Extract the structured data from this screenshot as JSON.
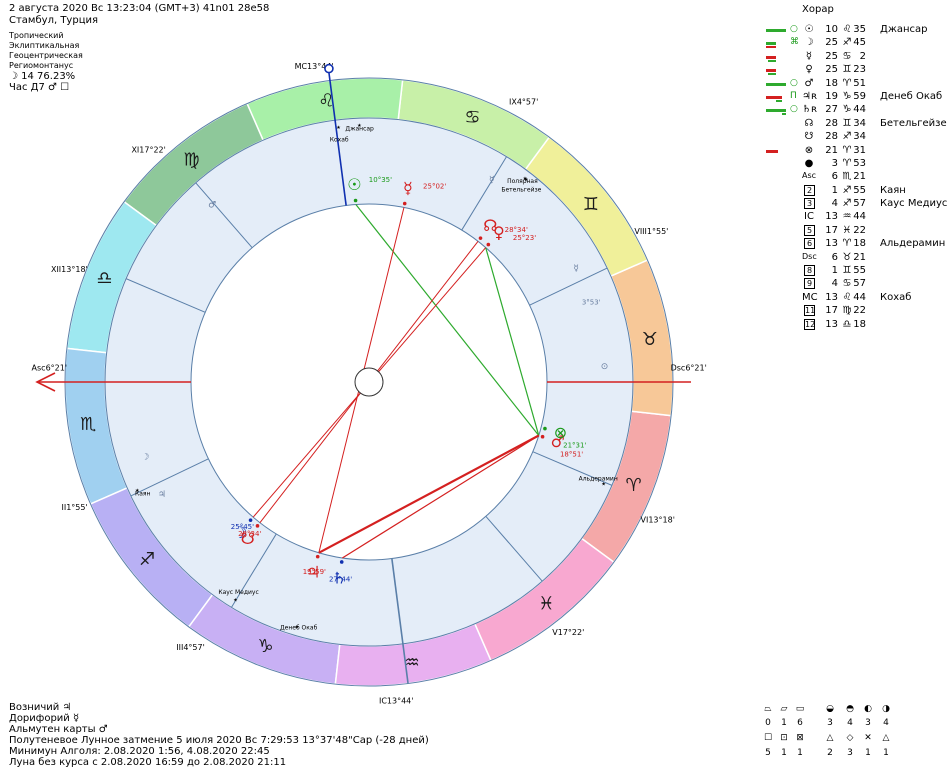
{
  "header": {
    "date_line": "2 августа 2020  Вс  13:23:04 (GMT+3) 41n01  28e58",
    "place": "Стамбул, Турция",
    "settings": [
      "Тропический",
      "Эклиптикальная",
      "Геоцентрическая",
      "Региомонтанус"
    ],
    "moon_phase": "☽  14 76.23%",
    "hour_line": "Час Д7  ♂ ☐"
  },
  "right_title": "Хорар",
  "planets": [
    {
      "mark": "○",
      "sym": "☉",
      "deg": "10",
      "sign": "♌",
      "min": "35",
      "star": "Джансар",
      "bar1": "#2eaa2e",
      "bar1w": 20,
      "bar2": "#2eaa2e",
      "bar2w": 0
    },
    {
      "mark": "⌘",
      "sym": "☽",
      "deg": "25",
      "sign": "♐",
      "min": "45",
      "star": "",
      "bar1": "#2eaa2e",
      "bar1w": 10,
      "bar2": "#d42020",
      "bar2w": 10
    },
    {
      "mark": "",
      "sym": "☿",
      "deg": "25",
      "sign": "♋",
      "min": "2",
      "star": "",
      "bar1": "#d42020",
      "bar1w": 10,
      "bar2": "#2eaa2e",
      "bar2w": 8
    },
    {
      "mark": "",
      "sym": "♀",
      "deg": "25",
      "sign": "♊",
      "min": "23",
      "star": "",
      "bar1": "#d42020",
      "bar1w": 10,
      "bar2": "#2eaa2e",
      "bar2w": 8
    },
    {
      "mark": "○",
      "sym": "♂",
      "deg": "18",
      "sign": "♈",
      "min": "51",
      "star": "",
      "bar1": "#2eaa2e",
      "bar1w": 20,
      "bar2": "#2eaa2e",
      "bar2w": 0
    },
    {
      "mark": "П",
      "sym": "♃ʀ",
      "deg": "19",
      "sign": "♑",
      "min": "59",
      "star": "Денеб Окаб",
      "bar1": "#d42020",
      "bar1w": 16,
      "bar2": "#2eaa2e",
      "bar2w": 6
    },
    {
      "mark": "○",
      "sym": "♄ʀ",
      "deg": "27",
      "sign": "♑",
      "min": "44",
      "star": "",
      "bar1": "#2eaa2e",
      "bar1w": 20,
      "bar2": "#2eaa2e",
      "bar2w": 4
    },
    {
      "mark": "",
      "sym": "☊",
      "deg": "28",
      "sign": "♊",
      "min": "34",
      "star": "Бетельгейзе",
      "bar1": "",
      "bar1w": 0,
      "bar2": "",
      "bar2w": 0
    },
    {
      "mark": "",
      "sym": "☋",
      "deg": "28",
      "sign": "♐",
      "min": "34",
      "star": "",
      "bar1": "",
      "bar1w": 0,
      "bar2": "",
      "bar2w": 0
    },
    {
      "mark": "",
      "sym": "⊗",
      "deg": "21",
      "sign": "♈",
      "min": "31",
      "star": "",
      "bar1": "#d42020",
      "bar1w": 12,
      "bar2": "",
      "bar2w": 0
    },
    {
      "mark": "",
      "sym": "●",
      "deg": "3",
      "sign": "♈",
      "min": "53",
      "star": "",
      "bar1": "",
      "bar1w": 0,
      "bar2": "",
      "bar2w": 0
    },
    {
      "mark": "",
      "sym": "Asc",
      "deg": "6",
      "sign": "♏",
      "min": "21",
      "star": "",
      "bar1": "",
      "bar1w": 0,
      "bar2": "",
      "bar2w": 0
    },
    {
      "mark": "",
      "sym": "2",
      "deg": "1",
      "sign": "♐",
      "min": "55",
      "star": "Каян",
      "bar1": "",
      "bar1w": 0,
      "bar2": "",
      "bar2w": 0
    },
    {
      "mark": "",
      "sym": "3",
      "deg": "4",
      "sign": "♐",
      "min": "57",
      "star": "Каус Медиус",
      "bar1": "",
      "bar1w": 0,
      "bar2": "",
      "bar2w": 0
    },
    {
      "mark": "",
      "sym": "IC",
      "deg": "13",
      "sign": "♒",
      "min": "44",
      "star": "",
      "bar1": "",
      "bar1w": 0,
      "bar2": "",
      "bar2w": 0
    },
    {
      "mark": "",
      "sym": "5",
      "deg": "17",
      "sign": "♓",
      "min": "22",
      "star": "",
      "bar1": "",
      "bar1w": 0,
      "bar2": "",
      "bar2w": 0
    },
    {
      "mark": "",
      "sym": "6",
      "deg": "13",
      "sign": "♈",
      "min": "18",
      "star": "Альдерамин",
      "bar1": "",
      "bar1w": 0,
      "bar2": "",
      "bar2w": 0
    },
    {
      "mark": "",
      "sym": "Dsc",
      "deg": "6",
      "sign": "♉",
      "min": "21",
      "star": "",
      "bar1": "",
      "bar1w": 0,
      "bar2": "",
      "bar2w": 0
    },
    {
      "mark": "",
      "sym": "8",
      "deg": "1",
      "sign": "♊",
      "min": "55",
      "star": "",
      "bar1": "",
      "bar1w": 0,
      "bar2": "",
      "bar2w": 0
    },
    {
      "mark": "",
      "sym": "9",
      "deg": "4",
      "sign": "♋",
      "min": "57",
      "star": "",
      "bar1": "",
      "bar1w": 0,
      "bar2": "",
      "bar2w": 0
    },
    {
      "mark": "",
      "sym": "MC",
      "deg": "13",
      "sign": "♌",
      "min": "44",
      "star": "Кохаб",
      "bar1": "",
      "bar1w": 0,
      "bar2": "",
      "bar2w": 0
    },
    {
      "mark": "",
      "sym": "11",
      "deg": "17",
      "sign": "♍",
      "min": "22",
      "star": "",
      "bar1": "",
      "bar1w": 0,
      "bar2": "",
      "bar2w": 0
    },
    {
      "mark": "",
      "sym": "12",
      "deg": "13",
      "sign": "♎",
      "min": "18",
      "star": "",
      "bar1": "",
      "bar1w": 0,
      "bar2": "",
      "bar2w": 0
    }
  ],
  "signs": [
    {
      "glyph": "♈",
      "color": "#f4a8a8"
    },
    {
      "glyph": "♉",
      "color": "#f7c898"
    },
    {
      "glyph": "♊",
      "color": "#f0f09a"
    },
    {
      "glyph": "♋",
      "color": "#c8f0a8"
    },
    {
      "glyph": "♌",
      "color": "#a8f0a8"
    },
    {
      "glyph": "♍",
      "color": "#8ec89a"
    },
    {
      "glyph": "♎",
      "color": "#9ee8f0"
    },
    {
      "glyph": "♏",
      "color": "#a0d0f0"
    },
    {
      "glyph": "♐",
      "color": "#b8b0f4"
    },
    {
      "glyph": "♑",
      "color": "#c8b0f4"
    },
    {
      "glyph": "♒",
      "color": "#e8b0f0"
    },
    {
      "glyph": "♓",
      "color": "#f8a8d0"
    }
  ],
  "asc_longitude": 216.35,
  "cusps": [
    {
      "label": "Asc6°21'",
      "lon": 216.35
    },
    {
      "label": "II1°55'",
      "lon": 241.92
    },
    {
      "label": "III4°57'",
      "lon": 274.95
    },
    {
      "label": "IC13°44'",
      "lon": 313.73
    },
    {
      "label": "V17°22'",
      "lon": 347.37
    },
    {
      "label": "VI13°18'",
      "lon": 13.3
    },
    {
      "label": "Dsc6°21'",
      "lon": 36.35
    },
    {
      "label": "VIII1°55'",
      "lon": 61.92
    },
    {
      "label": "IX4°57'",
      "lon": 94.95
    },
    {
      "label": "MC13°44'",
      "lon": 133.73
    },
    {
      "label": "XI17°22'",
      "lon": 167.37
    },
    {
      "label": "XII13°18'",
      "lon": 193.3
    }
  ],
  "chart_planets": [
    {
      "glyph": "☉",
      "label": "10°35'",
      "lon": 130.58,
      "color": "#1a9a1a"
    },
    {
      "glyph": "☽",
      "label": "25°45'",
      "lon": 265.75,
      "color": "#1030b0"
    },
    {
      "glyph": "☿",
      "label": "25°02'",
      "lon": 115.03,
      "color": "#d42020"
    },
    {
      "glyph": "♀",
      "label": "25°23'",
      "lon": 85.38,
      "color": "#d42020"
    },
    {
      "glyph": "♂",
      "label": "18°51'",
      "lon": 18.85,
      "color": "#d42020"
    },
    {
      "glyph": "♃",
      "label": "19°59'",
      "lon": 289.98,
      "color": "#d42020"
    },
    {
      "glyph": "♄",
      "label": "27°44'",
      "lon": 297.73,
      "color": "#1030b0"
    },
    {
      "glyph": "☊",
      "label": "28°34'",
      "lon": 88.57,
      "color": "#d42020"
    },
    {
      "glyph": "☋",
      "label": "28°34'",
      "lon": 268.57,
      "color": "#d42020"
    },
    {
      "glyph": "⊗",
      "label": "21°31'",
      "lon": 21.52,
      "color": "#1a9a1a"
    }
  ],
  "stars": [
    {
      "name": "Джансар",
      "lon": 128.5
    },
    {
      "name": "Кохаб",
      "lon": 133.2
    },
    {
      "name": "Полярная",
      "lon": 88.5
    },
    {
      "name": "Бетельгейзе",
      "lon": 88.8
    },
    {
      "name": "Альдерамин",
      "lon": 12.8
    },
    {
      "name": "Каян",
      "lon": 241.5
    },
    {
      "name": "Каус Медиус",
      "lon": 274.9
    },
    {
      "name": "Денеб Окаб",
      "lon": 290.0
    }
  ],
  "aux_marks": [
    {
      "glyph": "♂",
      "lon": 168
    },
    {
      "glyph": "☿",
      "lon": 95
    },
    {
      "glyph": "☿",
      "lon": 65
    },
    {
      "glyph": "⊙",
      "lon": 40
    },
    {
      "glyph": "☽",
      "lon": 235
    },
    {
      "glyph": "♃",
      "lon": 245
    },
    {
      "glyph": "3°53'",
      "lon": 56
    }
  ],
  "bottom": {
    "vozn": "Возничий  ♃",
    "dorif": "Дорифорий  ☿",
    "almuten": "Альмутен карты  ♂",
    "eclipse": "Полутеневое Лунное затмение 5 июля 2020 Вс  7:29:53 13°37'48\"Cap (-28 дней)",
    "algol": "Минимун Алголя: 2.08.2020  1:56,  4.08.2020 22:45",
    "moon_course": "Луна без курса с 2.08.2020 16:59 до 2.08.2020 21:11"
  },
  "legend": {
    "top_syms": [
      "⏢",
      "⏥",
      "▭",
      "◒",
      "◓",
      "◐",
      "◑"
    ],
    "top_vals": [
      "0",
      "1",
      "6",
      "3",
      "4",
      "3",
      "4"
    ],
    "bot_syms": [
      "☐",
      "⊡",
      "⊠",
      "△",
      "◇",
      "✕",
      "△"
    ],
    "bot_vals": [
      "5",
      "1",
      "1",
      "2",
      "3",
      "1",
      "1"
    ]
  }
}
